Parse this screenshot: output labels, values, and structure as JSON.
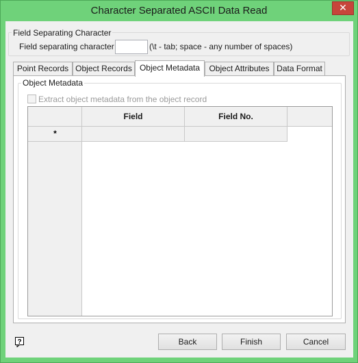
{
  "window": {
    "title": "Character Separated ASCII Data Read",
    "close_glyph": "✕"
  },
  "separator_group": {
    "legend": "Field Separating Character",
    "field_label": "Field separating character",
    "field_value": "",
    "hint": "(\\t - tab; space - any number of spaces)"
  },
  "tabs": [
    {
      "label": "Point Records",
      "active": false
    },
    {
      "label": "Object Records",
      "active": false
    },
    {
      "label": "Object Metadata",
      "active": true
    },
    {
      "label": "Object Attributes",
      "active": false
    },
    {
      "label": "Data Format",
      "active": false
    }
  ],
  "metadata_group": {
    "legend": "Object Metadata",
    "checkbox_label": "Extract object metadata from the object record",
    "checkbox_checked": false,
    "checkbox_enabled": false
  },
  "grid": {
    "columns": [
      "Field",
      "Field No."
    ],
    "new_row_marker": "*",
    "rows": []
  },
  "buttons": {
    "back": "Back",
    "finish": "Finish",
    "cancel": "Cancel"
  },
  "icons": {
    "help": "help-icon"
  }
}
